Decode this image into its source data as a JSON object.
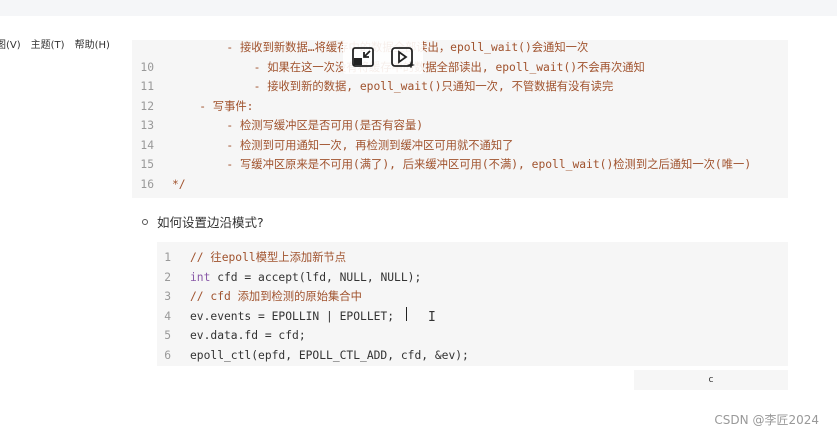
{
  "menu": [
    {
      "label": "图(V)"
    },
    {
      "label": "主题(T)"
    },
    {
      "label": "帮助(H)"
    }
  ],
  "block1": {
    "lines": [
      {
        "n": "",
        "indent": 8,
        "text": "- 接收到新数据…将缓存中的数据全部读出，epoll_wait()会通知一次",
        "cls": "c-comment"
      },
      {
        "n": "10",
        "indent": 12,
        "text": "- 如果在这一次没有将缓存中的数据全部读出, epoll_wait()不会再次通知",
        "cls": "c-comment"
      },
      {
        "n": "11",
        "indent": 12,
        "text": "- 接收到新的数据, epoll_wait()只通知一次, 不管数据有没有读完",
        "cls": "c-comment"
      },
      {
        "n": "12",
        "indent": 4,
        "text": "- 写事件:",
        "cls": "c-comment"
      },
      {
        "n": "13",
        "indent": 8,
        "text": "- 检测写缓冲区是否可用(是否有容量)",
        "cls": "c-comment"
      },
      {
        "n": "14",
        "indent": 8,
        "text": "- 检测到可用通知一次, 再检测到缓冲区可用就不通知了",
        "cls": "c-comment"
      },
      {
        "n": "15",
        "indent": 8,
        "text": "- 写缓冲区原来是不可用(满了), 后来缓冲区可用(不满), epoll_wait()检测到之后通知一次(唯一)",
        "cls": "c-comment"
      },
      {
        "n": "16",
        "indent": 0,
        "text": "*/",
        "cls": "c-comment"
      }
    ]
  },
  "question": "如何设置边沿模式?",
  "block2": {
    "lines": [
      {
        "n": "1",
        "segs": [
          {
            "t": "// 往epoll模型上添加新节点",
            "c": "c-comment"
          }
        ]
      },
      {
        "n": "2",
        "segs": [
          {
            "t": "int",
            "c": "c-kw"
          },
          {
            "t": " cfd = accept(lfd, NULL, NULL);",
            "c": "c-plain"
          }
        ]
      },
      {
        "n": "3",
        "segs": [
          {
            "t": "// cfd 添加到检测的原始集合中",
            "c": "c-comment"
          }
        ]
      },
      {
        "n": "4",
        "segs": [
          {
            "t": "ev.events = EPOLLIN | EPOLLET;",
            "c": "c-plain"
          }
        ]
      },
      {
        "n": "5",
        "segs": [
          {
            "t": "ev.data.fd = cfd;",
            "c": "c-plain"
          }
        ]
      },
      {
        "n": "6",
        "segs": [
          {
            "t": "epoll_ctl(epfd, EPOLL_CTL_ADD, cfd, &ev);",
            "c": "c-plain"
          }
        ]
      }
    ]
  },
  "lang_label": "c",
  "watermark": "CSDN @李匠2024",
  "ibeam_glyph": "I"
}
